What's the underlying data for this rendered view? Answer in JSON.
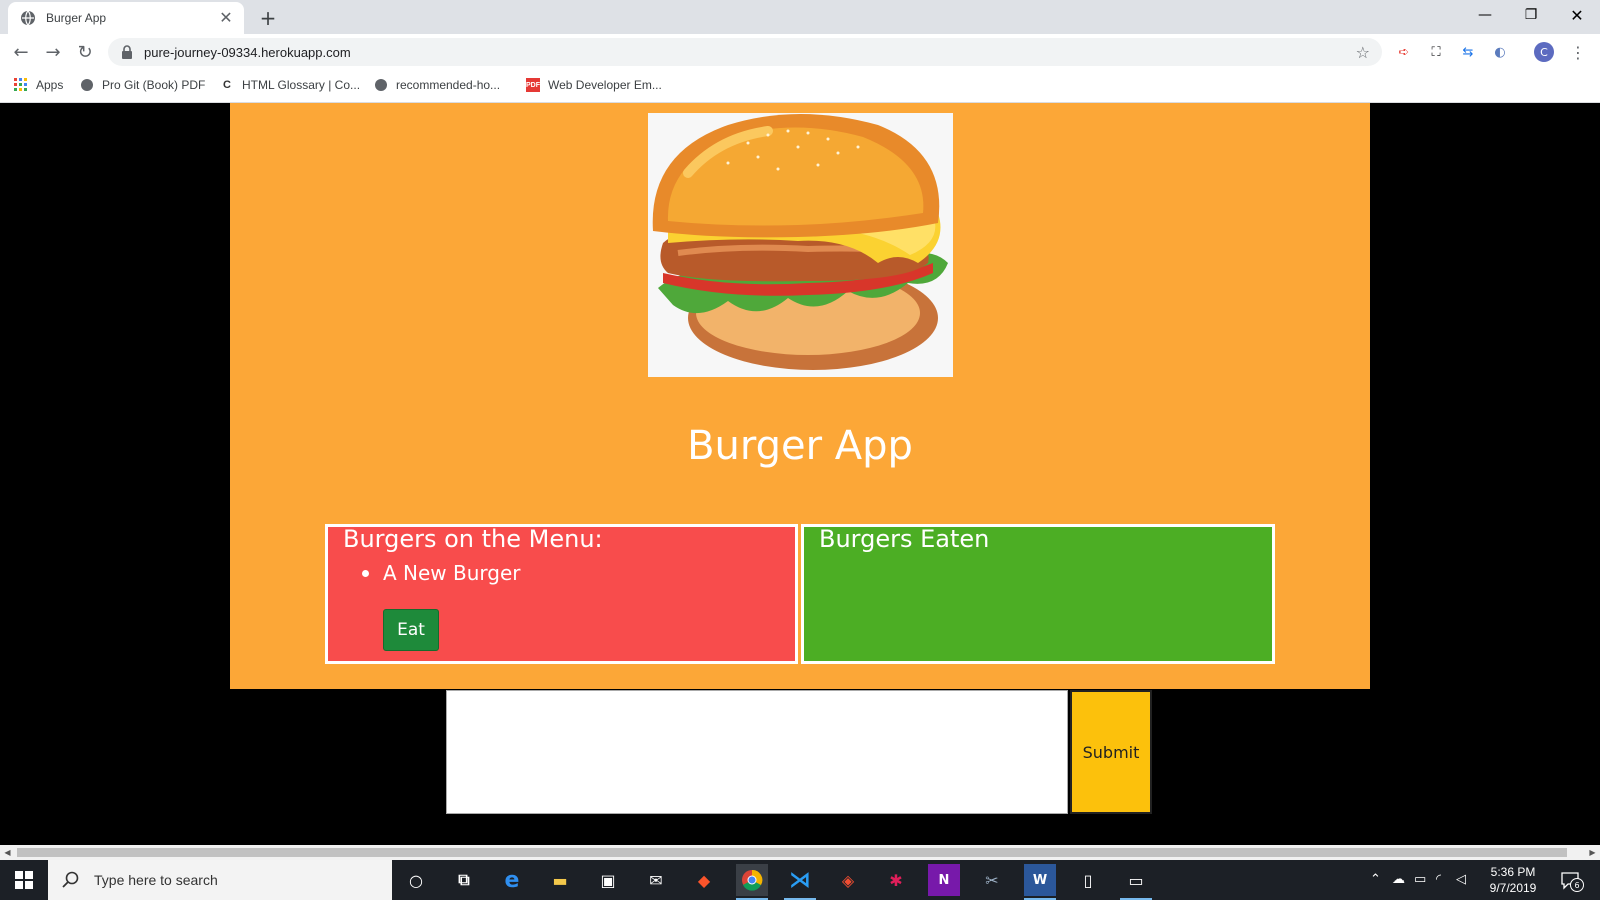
{
  "browser": {
    "tab_title": "Burger App",
    "url": "pure-journey-09334.herokuapp.com",
    "bookmarks": [
      "Apps",
      "Pro Git (Book) PDF",
      "HTML Glossary | Co...",
      "recommended-ho...",
      "Web Developer Em..."
    ],
    "profile_initial": "C"
  },
  "page": {
    "title": "Burger App",
    "menu_heading": "Burgers on the Menu:",
    "eaten_heading": "Burgers Eaten",
    "menu_items": [
      {
        "name": "A New Burger",
        "button_label": "Eat"
      }
    ],
    "eaten_items": [],
    "textarea_value": "",
    "submit_label": "Submit"
  },
  "taskbar": {
    "search_placeholder": "Type here to search",
    "time": "5:36 PM",
    "date": "9/7/2019",
    "notification_count": "6"
  },
  "colors": {
    "jumbotron": "#fca737",
    "menu_panel": "#f84c4c",
    "eaten_panel": "#4cae24",
    "eat_button": "#1e8a3a",
    "submit_button": "#fcc10c"
  }
}
